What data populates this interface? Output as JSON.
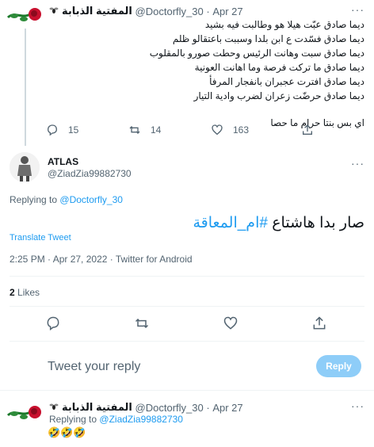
{
  "tweet1": {
    "display_name": "المفتية الذبابة",
    "handle": "@Doctorfly_30",
    "dot": "·",
    "date": "Apr 27",
    "more": "···",
    "lines": [
      "ديما صادق عبّت هيلا هو وطالبت فيه بشيد",
      "ديما صادق فسّدت ع ابن بلدا وسببت باعتقالو ظلم",
      "ديما صادق سبت وهانت الرئيس وحطت صورو بالمقلوب",
      "ديما صادق ما تركت فرصة وما اهانت العونية",
      "ديما صادق افترت عجبران بانفجار المرفأ",
      "ديما صادق حرضّت زعران لضرب وادية التيار"
    ],
    "last_line": "اي بس بنتا حرام ما حصا",
    "replies": "15",
    "retweets": "14",
    "likes": "163"
  },
  "tweet2": {
    "name": "ATLAS",
    "handle": "@ZiadZia99882730",
    "replying_prefix": "Replying to",
    "replying_handle": "@Doctorfly_30",
    "text": "صار بدا هاشتاع",
    "hashtag": "#ام_المعاقة",
    "translate": "Translate Tweet",
    "meta": "2:25 PM · Apr 27, 2022 · Twitter for Android",
    "likes_count": "2",
    "likes_label": "Likes"
  },
  "reply_box": {
    "placeholder": "Tweet your reply",
    "button": "Reply"
  },
  "tweet3": {
    "display_name": "المفتية الذبابة",
    "handle": "@Doctorfly_30",
    "dot": "·",
    "date": "Apr 27",
    "more": "···",
    "replying_prefix": "Replying to",
    "replying_handle": "@ZiadZia99882730",
    "text": "🤣🤣🤣"
  },
  "colors": {
    "accent": "#1d9bf0",
    "muted": "#536471",
    "reply_button": "#8ecdf8",
    "divider": "#eff3f4"
  },
  "icons": [
    "fly-icon",
    "rose-icon",
    "reply-icon",
    "retweet-icon",
    "like-icon",
    "share-icon",
    "more-icon"
  ]
}
